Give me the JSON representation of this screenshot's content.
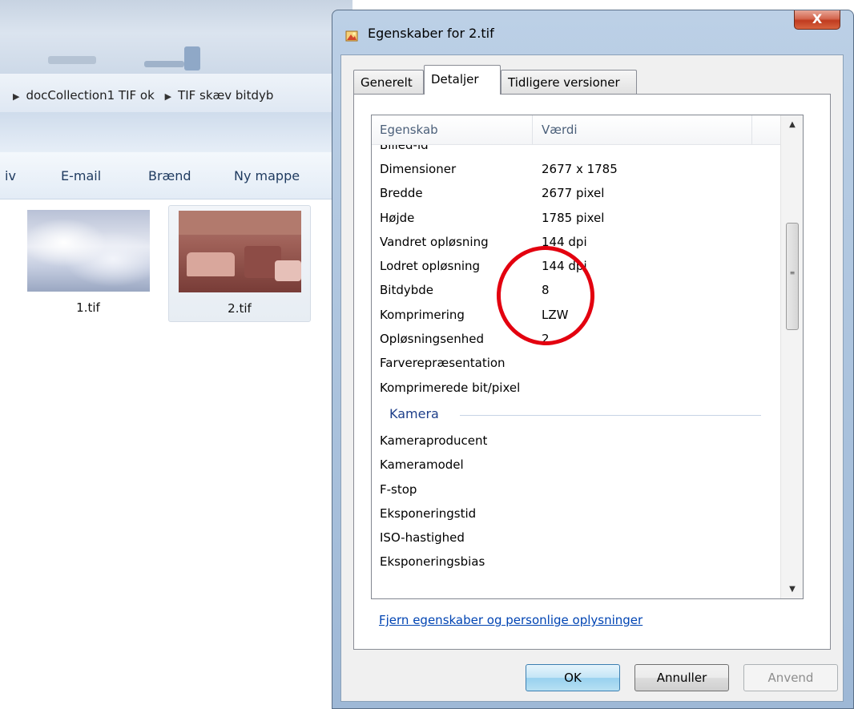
{
  "explorer": {
    "breadcrumb": [
      "docCollection1 TIF ok",
      "TIF skæv bitdyb"
    ],
    "toolbar": {
      "item_partial": "iv",
      "email": "E-mail",
      "braend": "Brænd",
      "ny_mappe": "Ny mappe"
    },
    "files": [
      {
        "name": "1.tif",
        "selected": false
      },
      {
        "name": "2.tif",
        "selected": true
      }
    ]
  },
  "dialog": {
    "title": "Egenskaber for 2.tif",
    "close_label": "X",
    "tabs": [
      {
        "label": "Generelt",
        "active": false
      },
      {
        "label": "Detaljer",
        "active": true
      },
      {
        "label": "Tidligere versioner",
        "active": false
      }
    ],
    "list": {
      "header": {
        "property": "Egenskab",
        "value": "Værdi"
      },
      "rows": [
        {
          "k": "Billed-id",
          "v": ""
        },
        {
          "k": "Dimensioner",
          "v": "2677 x 1785"
        },
        {
          "k": "Bredde",
          "v": "2677 pixel"
        },
        {
          "k": "Højde",
          "v": "1785 pixel"
        },
        {
          "k": "Vandret opløsning",
          "v": "144 dpi"
        },
        {
          "k": "Lodret opløsning",
          "v": "144 dpi"
        },
        {
          "k": "Bitdybde",
          "v": "8"
        },
        {
          "k": "Komprimering",
          "v": "LZW"
        },
        {
          "k": "Opløsningsenhed",
          "v": "2"
        },
        {
          "k": "Farverepræsentation",
          "v": ""
        },
        {
          "k": "Komprimerede bit/pixel",
          "v": ""
        }
      ],
      "group": "Kamera",
      "group_rows": [
        {
          "k": "Kameraproducent",
          "v": ""
        },
        {
          "k": "Kameramodel",
          "v": ""
        },
        {
          "k": "F-stop",
          "v": ""
        },
        {
          "k": "Eksponeringstid",
          "v": ""
        },
        {
          "k": "ISO-hastighed",
          "v": ""
        },
        {
          "k": "Eksponeringsbias",
          "v": ""
        }
      ]
    },
    "remove_link": "Fjern egenskaber og personlige oplysninger",
    "buttons": {
      "ok": "OK",
      "cancel": "Annuller",
      "apply": "Anvend"
    }
  },
  "annotation_color": "#e3000f"
}
